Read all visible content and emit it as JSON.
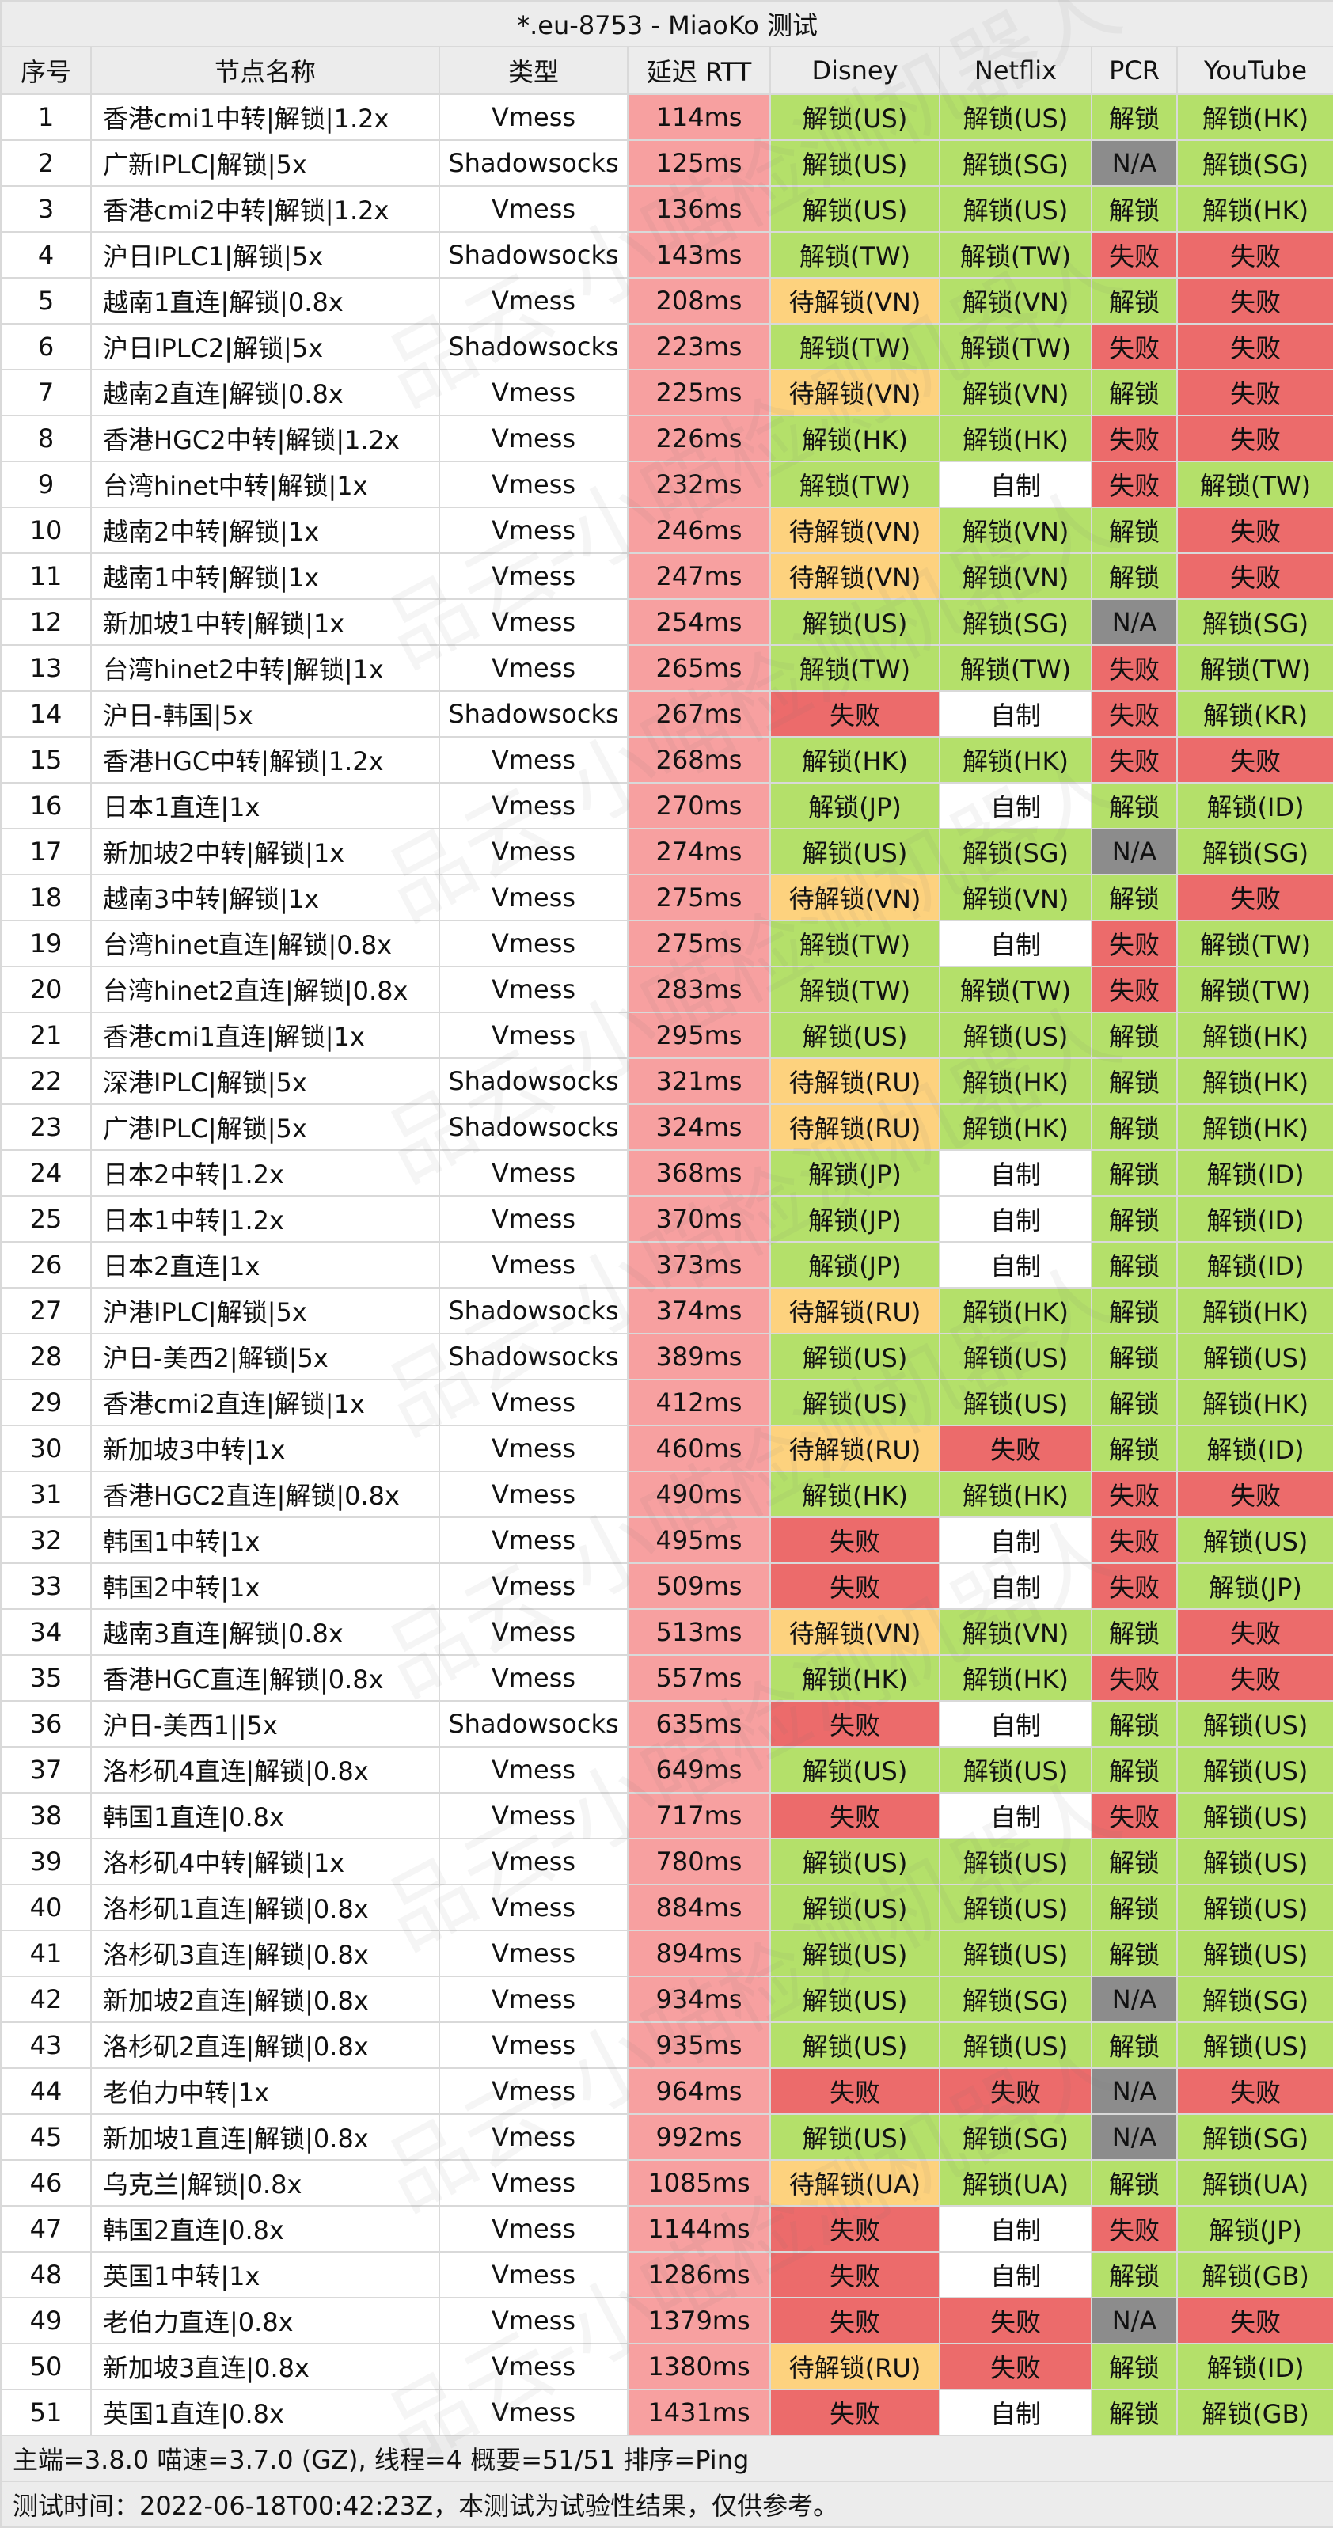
{
  "title": "*.eu-8753 - MiaoKo 测试",
  "headers": [
    "序号",
    "节点名称",
    "类型",
    "延迟 RTT",
    "Disney",
    "Netflix",
    "PCR",
    "YouTube"
  ],
  "rows": [
    [
      "1",
      "香港cmi1中转|解锁|1.2x",
      "Vmess",
      "114ms",
      "解锁(US)",
      "解锁(US)",
      "解锁",
      "解锁(HK)"
    ],
    [
      "2",
      "广新IPLC|解锁|5x",
      "Shadowsocks",
      "125ms",
      "解锁(US)",
      "解锁(SG)",
      "N/A",
      "解锁(SG)"
    ],
    [
      "3",
      "香港cmi2中转|解锁|1.2x",
      "Vmess",
      "136ms",
      "解锁(US)",
      "解锁(US)",
      "解锁",
      "解锁(HK)"
    ],
    [
      "4",
      "沪日IPLC1|解锁|5x",
      "Shadowsocks",
      "143ms",
      "解锁(TW)",
      "解锁(TW)",
      "失败",
      "失败"
    ],
    [
      "5",
      "越南1直连|解锁|0.8x",
      "Vmess",
      "208ms",
      "待解锁(VN)",
      "解锁(VN)",
      "解锁",
      "失败"
    ],
    [
      "6",
      "沪日IPLC2|解锁|5x",
      "Shadowsocks",
      "223ms",
      "解锁(TW)",
      "解锁(TW)",
      "失败",
      "失败"
    ],
    [
      "7",
      "越南2直连|解锁|0.8x",
      "Vmess",
      "225ms",
      "待解锁(VN)",
      "解锁(VN)",
      "解锁",
      "失败"
    ],
    [
      "8",
      "香港HGC2中转|解锁|1.2x",
      "Vmess",
      "226ms",
      "解锁(HK)",
      "解锁(HK)",
      "失败",
      "失败"
    ],
    [
      "9",
      "台湾hinet中转|解锁|1x",
      "Vmess",
      "232ms",
      "解锁(TW)",
      "自制",
      "失败",
      "解锁(TW)"
    ],
    [
      "10",
      "越南2中转|解锁|1x",
      "Vmess",
      "246ms",
      "待解锁(VN)",
      "解锁(VN)",
      "解锁",
      "失败"
    ],
    [
      "11",
      "越南1中转|解锁|1x",
      "Vmess",
      "247ms",
      "待解锁(VN)",
      "解锁(VN)",
      "解锁",
      "失败"
    ],
    [
      "12",
      "新加坡1中转|解锁|1x",
      "Vmess",
      "254ms",
      "解锁(US)",
      "解锁(SG)",
      "N/A",
      "解锁(SG)"
    ],
    [
      "13",
      "台湾hinet2中转|解锁|1x",
      "Vmess",
      "265ms",
      "解锁(TW)",
      "解锁(TW)",
      "失败",
      "解锁(TW)"
    ],
    [
      "14",
      "沪日-韩国|5x",
      "Shadowsocks",
      "267ms",
      "失败",
      "自制",
      "失败",
      "解锁(KR)"
    ],
    [
      "15",
      "香港HGC中转|解锁|1.2x",
      "Vmess",
      "268ms",
      "解锁(HK)",
      "解锁(HK)",
      "失败",
      "失败"
    ],
    [
      "16",
      "日本1直连|1x",
      "Vmess",
      "270ms",
      "解锁(JP)",
      "自制",
      "解锁",
      "解锁(ID)"
    ],
    [
      "17",
      "新加坡2中转|解锁|1x",
      "Vmess",
      "274ms",
      "解锁(US)",
      "解锁(SG)",
      "N/A",
      "解锁(SG)"
    ],
    [
      "18",
      "越南3中转|解锁|1x",
      "Vmess",
      "275ms",
      "待解锁(VN)",
      "解锁(VN)",
      "解锁",
      "失败"
    ],
    [
      "19",
      "台湾hinet直连|解锁|0.8x",
      "Vmess",
      "275ms",
      "解锁(TW)",
      "自制",
      "失败",
      "解锁(TW)"
    ],
    [
      "20",
      "台湾hinet2直连|解锁|0.8x",
      "Vmess",
      "283ms",
      "解锁(TW)",
      "解锁(TW)",
      "失败",
      "解锁(TW)"
    ],
    [
      "21",
      "香港cmi1直连|解锁|1x",
      "Vmess",
      "295ms",
      "解锁(US)",
      "解锁(US)",
      "解锁",
      "解锁(HK)"
    ],
    [
      "22",
      "深港IPLC|解锁|5x",
      "Shadowsocks",
      "321ms",
      "待解锁(RU)",
      "解锁(HK)",
      "解锁",
      "解锁(HK)"
    ],
    [
      "23",
      "广港IPLC|解锁|5x",
      "Shadowsocks",
      "324ms",
      "待解锁(RU)",
      "解锁(HK)",
      "解锁",
      "解锁(HK)"
    ],
    [
      "24",
      "日本2中转|1.2x",
      "Vmess",
      "368ms",
      "解锁(JP)",
      "自制",
      "解锁",
      "解锁(ID)"
    ],
    [
      "25",
      "日本1中转|1.2x",
      "Vmess",
      "370ms",
      "解锁(JP)",
      "自制",
      "解锁",
      "解锁(ID)"
    ],
    [
      "26",
      "日本2直连|1x",
      "Vmess",
      "373ms",
      "解锁(JP)",
      "自制",
      "解锁",
      "解锁(ID)"
    ],
    [
      "27",
      "沪港IPLC|解锁|5x",
      "Shadowsocks",
      "374ms",
      "待解锁(RU)",
      "解锁(HK)",
      "解锁",
      "解锁(HK)"
    ],
    [
      "28",
      "沪日-美西2|解锁|5x",
      "Shadowsocks",
      "389ms",
      "解锁(US)",
      "解锁(US)",
      "解锁",
      "解锁(US)"
    ],
    [
      "29",
      "香港cmi2直连|解锁|1x",
      "Vmess",
      "412ms",
      "解锁(US)",
      "解锁(US)",
      "解锁",
      "解锁(HK)"
    ],
    [
      "30",
      "新加坡3中转|1x",
      "Vmess",
      "460ms",
      "待解锁(RU)",
      "失败",
      "解锁",
      "解锁(ID)"
    ],
    [
      "31",
      "香港HGC2直连|解锁|0.8x",
      "Vmess",
      "490ms",
      "解锁(HK)",
      "解锁(HK)",
      "失败",
      "失败"
    ],
    [
      "32",
      "韩国1中转|1x",
      "Vmess",
      "495ms",
      "失败",
      "自制",
      "失败",
      "解锁(US)"
    ],
    [
      "33",
      "韩国2中转|1x",
      "Vmess",
      "509ms",
      "失败",
      "自制",
      "失败",
      "解锁(JP)"
    ],
    [
      "34",
      "越南3直连|解锁|0.8x",
      "Vmess",
      "513ms",
      "待解锁(VN)",
      "解锁(VN)",
      "解锁",
      "失败"
    ],
    [
      "35",
      "香港HGC直连|解锁|0.8x",
      "Vmess",
      "557ms",
      "解锁(HK)",
      "解锁(HK)",
      "失败",
      "失败"
    ],
    [
      "36",
      "沪日-美西1||5x",
      "Shadowsocks",
      "635ms",
      "失败",
      "自制",
      "解锁",
      "解锁(US)"
    ],
    [
      "37",
      "洛杉矶4直连|解锁|0.8x",
      "Vmess",
      "649ms",
      "解锁(US)",
      "解锁(US)",
      "解锁",
      "解锁(US)"
    ],
    [
      "38",
      "韩国1直连|0.8x",
      "Vmess",
      "717ms",
      "失败",
      "自制",
      "失败",
      "解锁(US)"
    ],
    [
      "39",
      "洛杉矶4中转|解锁|1x",
      "Vmess",
      "780ms",
      "解锁(US)",
      "解锁(US)",
      "解锁",
      "解锁(US)"
    ],
    [
      "40",
      "洛杉矶1直连|解锁|0.8x",
      "Vmess",
      "884ms",
      "解锁(US)",
      "解锁(US)",
      "解锁",
      "解锁(US)"
    ],
    [
      "41",
      "洛杉矶3直连|解锁|0.8x",
      "Vmess",
      "894ms",
      "解锁(US)",
      "解锁(US)",
      "解锁",
      "解锁(US)"
    ],
    [
      "42",
      "新加坡2直连|解锁|0.8x",
      "Vmess",
      "934ms",
      "解锁(US)",
      "解锁(SG)",
      "N/A",
      "解锁(SG)"
    ],
    [
      "43",
      "洛杉矶2直连|解锁|0.8x",
      "Vmess",
      "935ms",
      "解锁(US)",
      "解锁(US)",
      "解锁",
      "解锁(US)"
    ],
    [
      "44",
      "老伯力中转|1x",
      "Vmess",
      "964ms",
      "失败",
      "失败",
      "N/A",
      "失败"
    ],
    [
      "45",
      "新加坡1直连|解锁|0.8x",
      "Vmess",
      "992ms",
      "解锁(US)",
      "解锁(SG)",
      "N/A",
      "解锁(SG)"
    ],
    [
      "46",
      "乌克兰|解锁|0.8x",
      "Vmess",
      "1085ms",
      "待解锁(UA)",
      "解锁(UA)",
      "解锁",
      "解锁(UA)"
    ],
    [
      "47",
      "韩国2直连|0.8x",
      "Vmess",
      "1144ms",
      "失败",
      "自制",
      "失败",
      "解锁(JP)"
    ],
    [
      "48",
      "英国1中转|1x",
      "Vmess",
      "1286ms",
      "失败",
      "自制",
      "解锁",
      "解锁(GB)"
    ],
    [
      "49",
      "老伯力直连|0.8x",
      "Vmess",
      "1379ms",
      "失败",
      "失败",
      "N/A",
      "失败"
    ],
    [
      "50",
      "新加坡3直连|0.8x",
      "Vmess",
      "1380ms",
      "待解锁(RU)",
      "失败",
      "解锁",
      "解锁(ID)"
    ],
    [
      "51",
      "英国1直连|0.8x",
      "Vmess",
      "1431ms",
      "失败",
      "自制",
      "解锁",
      "解锁(GB)"
    ]
  ],
  "footer": {
    "line1": "主端=3.8.0 喵速=3.7.0 (GZ), 线程=4 概要=51/51 排序=Ping",
    "line2": "测试时间：2022-06-18T00:42:23Z，本测试为试验性结果，仅供参考。"
  },
  "watermark": "品云-小喵检测机器人",
  "colors": {
    "ok": "#b4e06a",
    "pending": "#fdd27e",
    "fail": "#ec6b6b",
    "na": "#8c8c8c",
    "self": "#ffffff",
    "latency": "#f7a0a0",
    "header_bg": "#ececec"
  }
}
